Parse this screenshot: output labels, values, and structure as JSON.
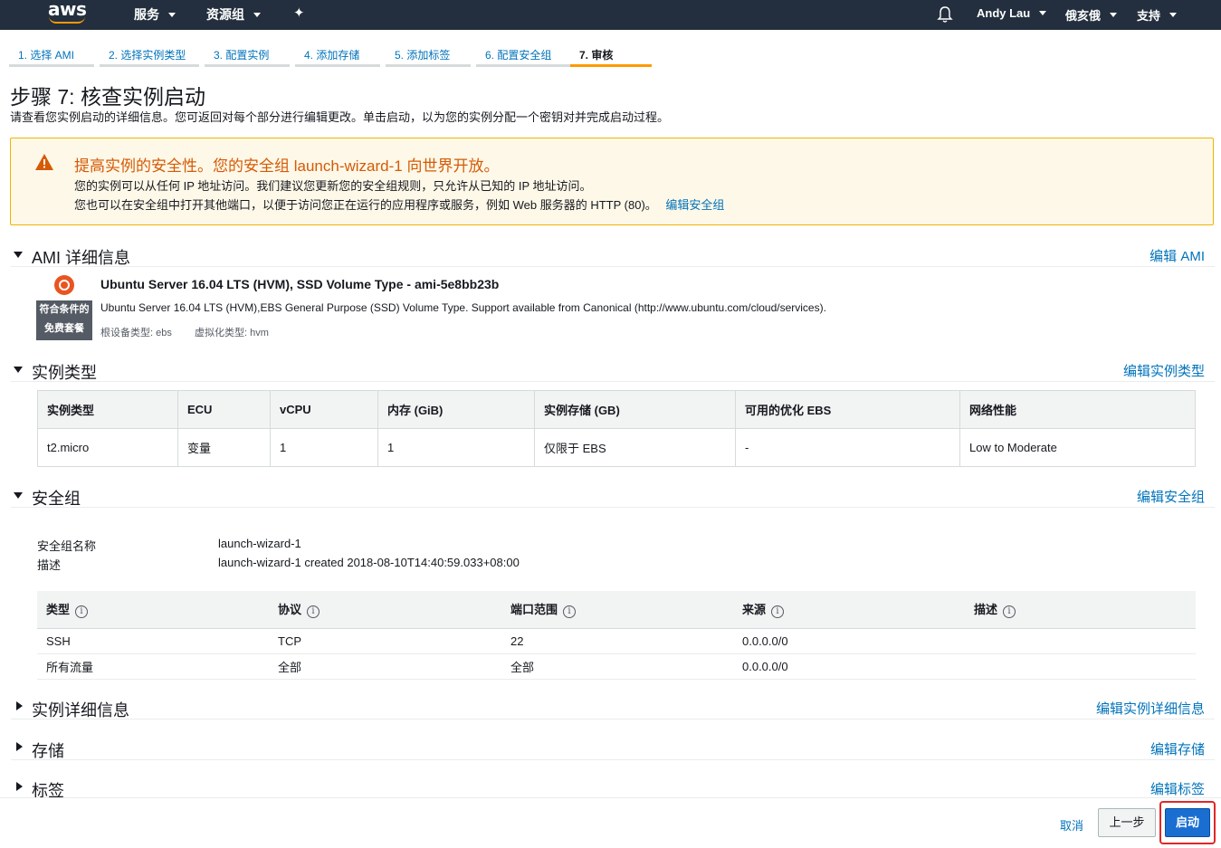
{
  "nav": {
    "logo": "aws",
    "services": "服务",
    "resource_groups": "资源组",
    "user": "Andy Lau",
    "region": "俄亥俄",
    "support": "支持"
  },
  "steps": [
    "1. 选择 AMI",
    "2. 选择实例类型",
    "3. 配置实例",
    "4. 添加存储",
    "5. 添加标签",
    "6. 配置安全组",
    "7. 审核"
  ],
  "page": {
    "title": "步骤 7: 核查实例启动",
    "subtitle": "请查看您实例启动的详细信息。您可返回对每个部分进行编辑更改。单击启动，以为您的实例分配一个密钥对并完成启动过程。"
  },
  "warning": {
    "title": "提高实例的安全性。您的安全组 launch-wizard-1 向世界开放。",
    "line1": "您的实例可以从任何 IP 地址访问。我们建议您更新您的安全组规则，只允许从已知的 IP 地址访问。",
    "line2": "您也可以在安全组中打开其他端口，以便于访问您正在运行的应用程序或服务，例如 Web 服务器的 HTTP (80)。",
    "link": "编辑安全组"
  },
  "ami": {
    "section_title": "AMI 详细信息",
    "edit": "编辑 AMI",
    "free_tier_1": "符合条件的",
    "free_tier_2": "免费套餐",
    "name": "Ubuntu Server 16.04 LTS (HVM), SSD Volume Type - ami-5e8bb23b",
    "description": "Ubuntu Server 16.04 LTS (HVM),EBS General Purpose (SSD) Volume Type. Support available from Canonical (http://www.ubuntu.com/cloud/services).",
    "root_device": "根设备类型: ebs",
    "virtualization": "虚拟化类型: hvm"
  },
  "instance_type": {
    "section_title": "实例类型",
    "edit": "编辑实例类型",
    "headers": [
      "实例类型",
      "ECU",
      "vCPU",
      "内存 (GiB)",
      "实例存储 (GB)",
      "可用的优化 EBS",
      "网络性能"
    ],
    "row": [
      "t2.micro",
      "变量",
      "1",
      "1",
      "仅限于 EBS",
      "-",
      "Low to Moderate"
    ]
  },
  "security_group": {
    "section_title": "安全组",
    "edit": "编辑安全组",
    "name_label": "安全组名称",
    "name_value": "launch-wizard-1",
    "desc_label": "描述",
    "desc_value": "launch-wizard-1 created 2018-08-10T14:40:59.033+08:00",
    "headers": [
      "类型",
      "协议",
      "端口范围",
      "来源",
      "描述"
    ],
    "rows": [
      [
        "SSH",
        "TCP",
        "22",
        "0.0.0.0/0",
        ""
      ],
      [
        "所有流量",
        "全部",
        "全部",
        "0.0.0.0/0",
        ""
      ]
    ]
  },
  "collapsed": {
    "instance_details": "实例详细信息",
    "instance_details_edit": "编辑实例详细信息",
    "storage": "存储",
    "storage_edit": "编辑存储",
    "tags": "标签",
    "tags_edit": "编辑标签"
  },
  "footer": {
    "cancel": "取消",
    "previous": "上一步",
    "launch": "启动"
  }
}
